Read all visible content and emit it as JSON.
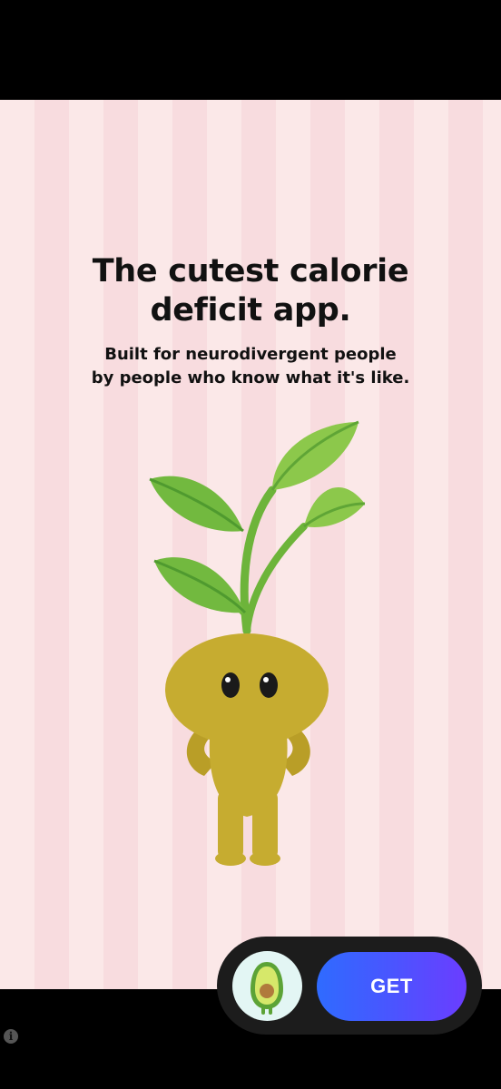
{
  "ad": {
    "headline": [
      "The cutest calorie",
      "deficit app."
    ],
    "subline": [
      "Built for neurodivergent people",
      "by people who know what it's like."
    ],
    "colors": {
      "stripe_light": "#fbe8e8",
      "stripe_dark": "#f8dcdf",
      "leaf_green": "#7cc242",
      "body_mustard": "#c6ac30",
      "cta_gradient_start": "#2f6bff",
      "cta_gradient_end": "#6b3dff"
    },
    "mascot": "sprout-character-illustration"
  },
  "cta": {
    "app_icon": "avocado-icon",
    "button_label": "GET"
  },
  "footer": {
    "info_icon": "info-icon",
    "info_glyph": "i"
  }
}
